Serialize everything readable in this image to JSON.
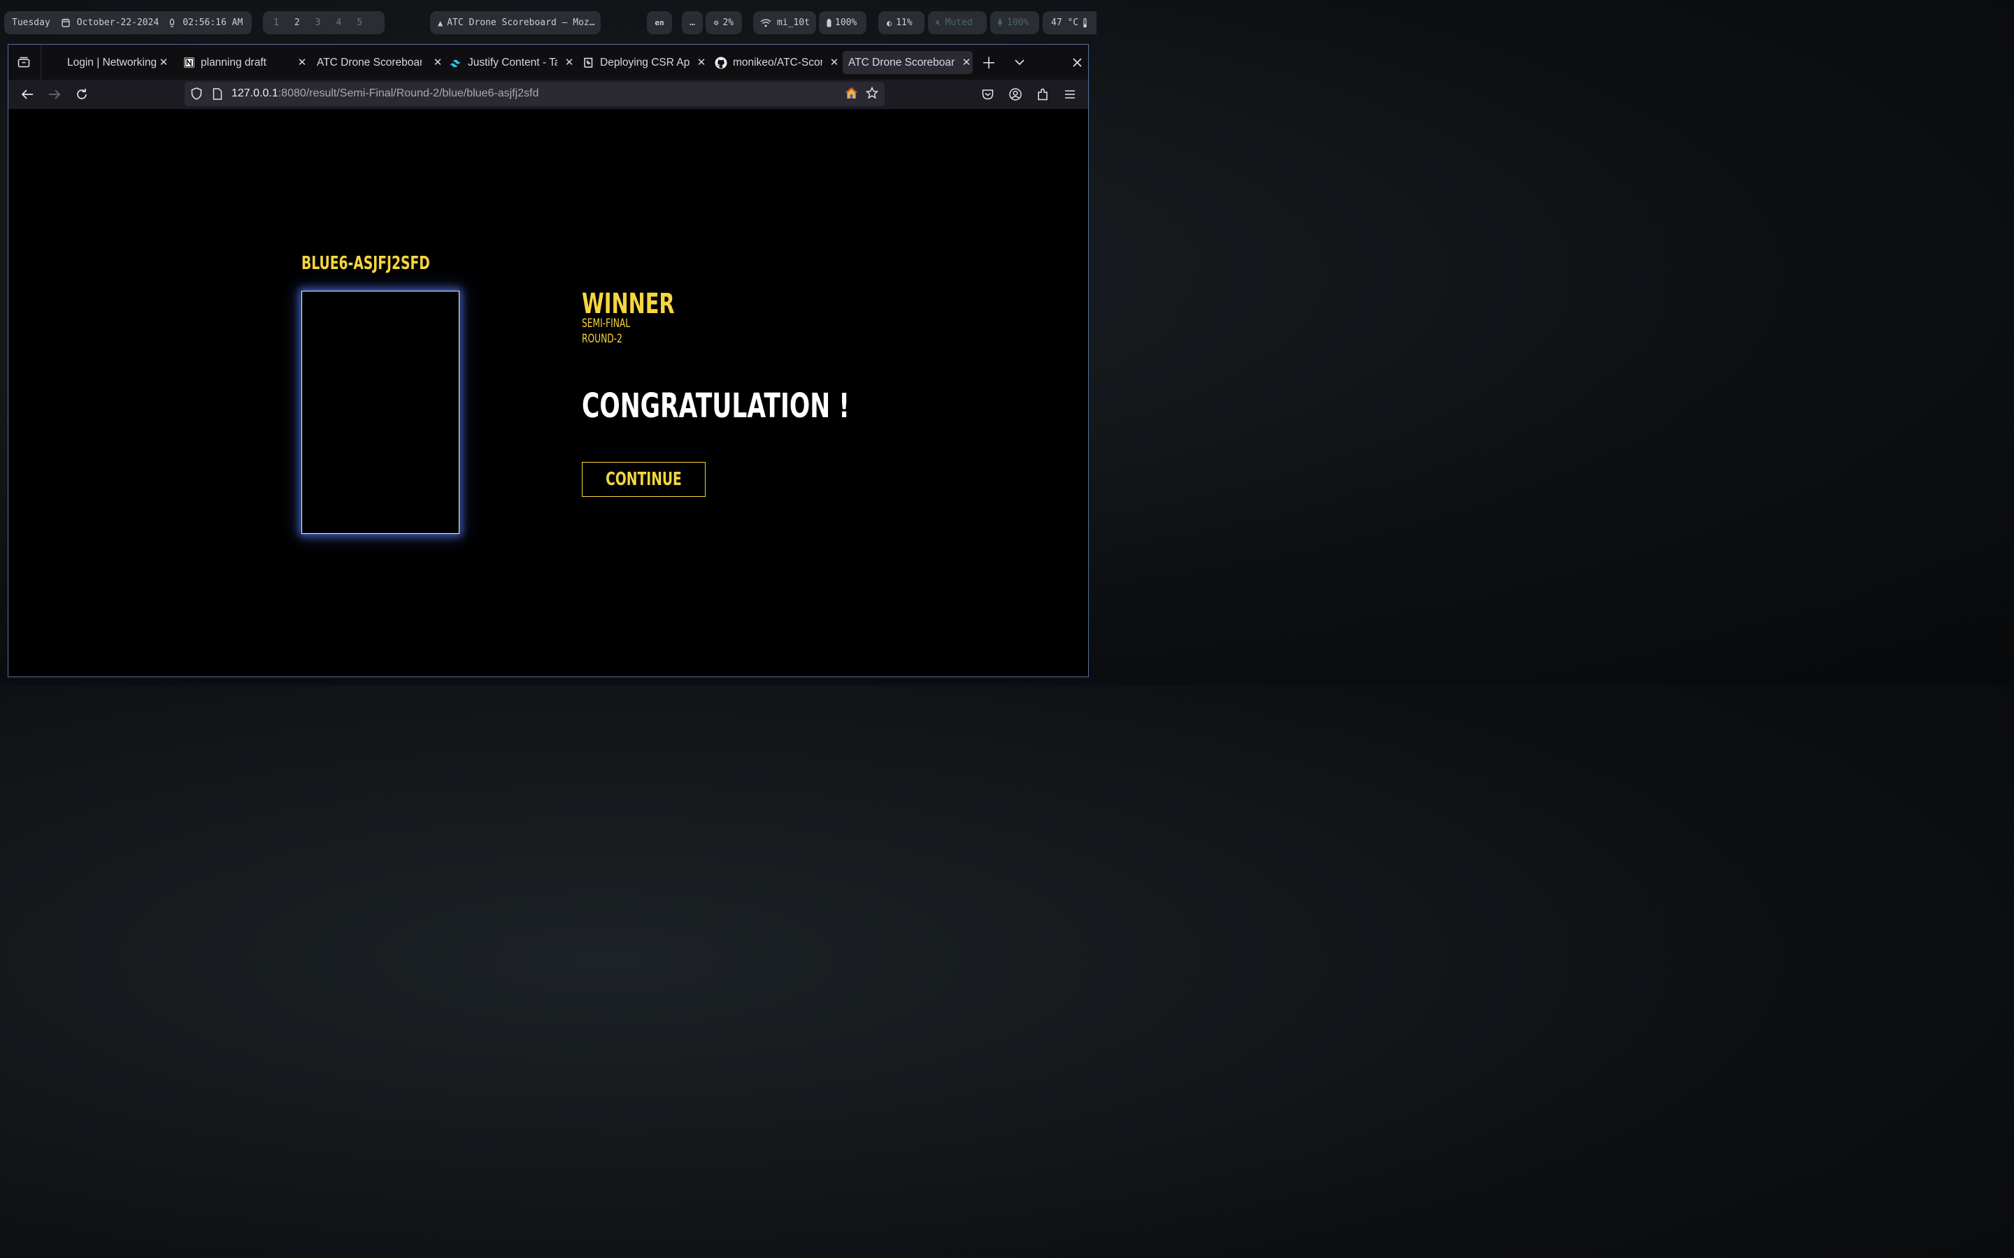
{
  "topbar": {
    "day": "Tuesday",
    "date": "October-22-2024",
    "time": "02:56:16 AM",
    "workspaces": [
      "1",
      "2",
      "3",
      "4",
      "5"
    ],
    "active_window": "ATC Drone Scoreboard — Moz…",
    "lang": "en",
    "more": "…",
    "cpu": "2%",
    "wifi": "mi_10t",
    "battery": "100%",
    "brightness": "11%",
    "volume": "Muted",
    "mic": "100%",
    "temp": "47 °C"
  },
  "tabs": [
    {
      "label": "Login | Networking",
      "icon": "none"
    },
    {
      "label": "planning draft",
      "icon": "notion-icon"
    },
    {
      "label": "ATC Drone Scoreboard",
      "icon": "none"
    },
    {
      "label": "Justify Content - Tailwind",
      "icon": "tailwind-icon"
    },
    {
      "label": "Deploying CSR App",
      "icon": "book-icon"
    },
    {
      "label": "monikeo/ATC-Scoreboard",
      "icon": "github-icon"
    },
    {
      "label": "ATC Drone Scoreboard",
      "icon": "none"
    }
  ],
  "url": {
    "host": "127.0.0.1",
    "rest": ":8080/result/Semi-Final/Round-2/blue/blue6-asjfj2sfd"
  },
  "page": {
    "team_name": "BLUE6-ASJFJ2SFD",
    "result": "WINNER",
    "stage": "SEMI-FINAL",
    "round": "ROUND-2",
    "message": "CONGRATULATION !",
    "continue_label": "CONTINUE"
  },
  "colors": {
    "accent": "#f6d63f",
    "page_bg": "#000000",
    "frame_glow": "#4a6fd8"
  }
}
